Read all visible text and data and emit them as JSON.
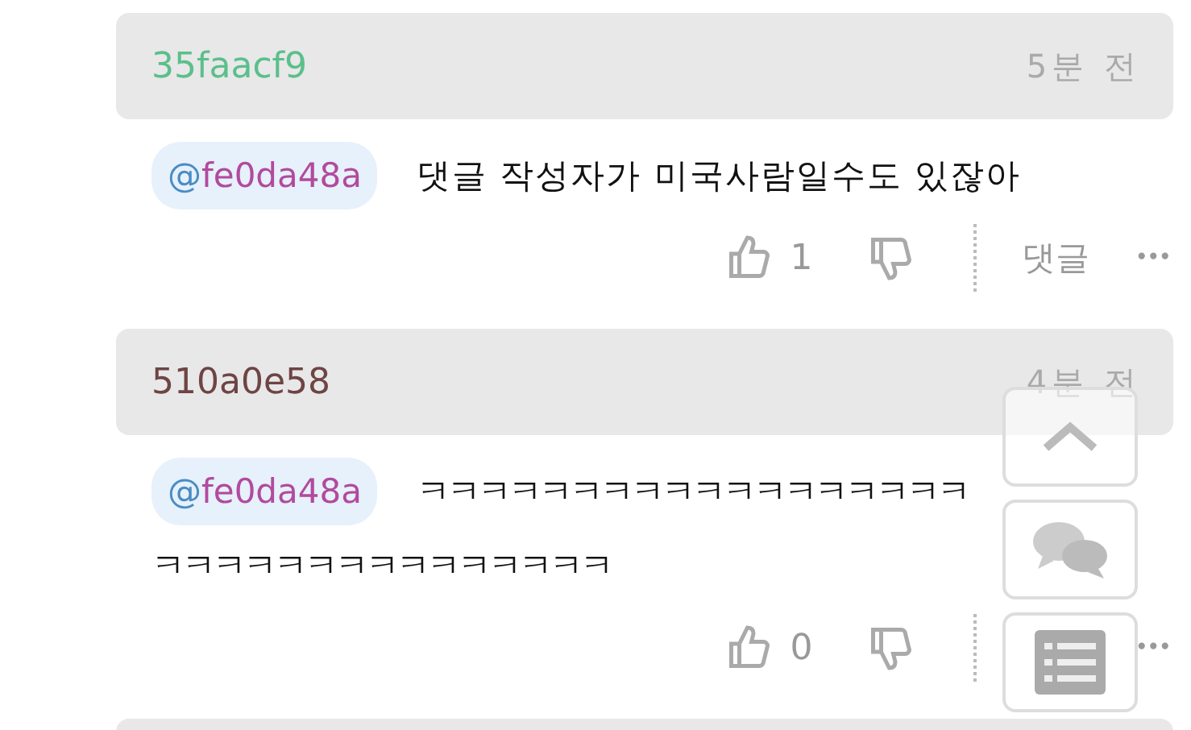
{
  "comments": [
    {
      "author": "35faacf9",
      "color": "#5bbf8c",
      "time": "5분 전",
      "mention": "@fe0da48a",
      "lines": [
        "댓글 작성자가 미국사람일수도 있잖아"
      ],
      "likes": "1",
      "reply": "댓글",
      "more": "•••"
    },
    {
      "author": "510a0e58",
      "color": "#6e4444",
      "time": "4분 전",
      "mention": "@fe0da48a",
      "lines": [
        "ㅋㅋㅋㅋㅋㅋㅋㅋㅋㅋㅋㅋㅋㅋㅋㅋㅋㅋ",
        "ㅋㅋㅋㅋㅋㅋㅋㅋㅋㅋㅋㅋㅋㅋㅋ"
      ],
      "likes": "0",
      "more": "•••"
    }
  ]
}
